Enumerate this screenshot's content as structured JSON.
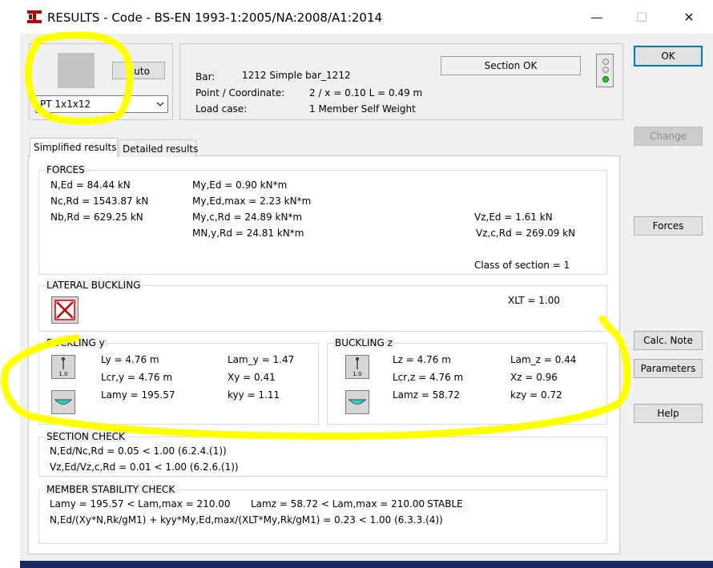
{
  "window": {
    "title": "RESULTS - Code - BS-EN 1993-1:2005/NA:2008/A1:2014",
    "minimize": "—",
    "maximize": "☐",
    "close": "✕"
  },
  "section_picker": {
    "auto_label": "Auto",
    "selected": "PT 1x1x12"
  },
  "info": {
    "bar_label": "Bar:",
    "bar_value": "1212  Simple bar_1212",
    "point_label": "Point / Coordinate:",
    "point_value": "2 / x = 0.10 L = 0.49 m",
    "load_label": "Load case:",
    "load_value": "1 Member Self Weight",
    "status": "Section OK",
    "status_color": "#22cc22"
  },
  "buttons": {
    "ok": "OK",
    "change": "Change",
    "forces": "Forces",
    "calc_note": "Calc. Note",
    "parameters": "Parameters",
    "help": "Help"
  },
  "tabs": [
    "Simplified results",
    "Detailed results"
  ],
  "forces": {
    "title": "FORCES",
    "n_ed": "N,Ed = 84.44 kN",
    "nc_rd": "Nc,Rd = 1543.87 kN",
    "nb_rd": "Nb,Rd = 629.25 kN",
    "my_ed": "My,Ed = 0.90 kN*m",
    "my_ed_max": "My,Ed,max = 2.23 kN*m",
    "my_c_rd": "My,c,Rd = 24.89 kN*m",
    "mn_y_rd": "MN,y,Rd = 24.81 kN*m",
    "vz_ed": "Vz,Ed = 1.61 kN",
    "vz_c_rd": "Vz,c,Rd = 269.09 kN",
    "class": "Class of section = 1"
  },
  "lateral": {
    "title": "LATERAL BUCKLING",
    "xlt": "XLT = 1.00"
  },
  "buckling_y": {
    "title": "BUCKLING y",
    "icon_label": "1.0",
    "ly": "Ly = 4.76 m",
    "lcr": "Lcr,y = 4.76 m",
    "lam": "Lamy = 195.57",
    "lam_rel": "Lam_y = 1.47",
    "x": "Xy = 0.41",
    "k": "kyy = 1.11"
  },
  "buckling_z": {
    "title": "BUCKLING z",
    "icon_label": "1.0",
    "lz": "Lz = 4.76 m",
    "lcr": "Lcr,z = 4.76 m",
    "lam": "Lamz = 58.72",
    "lam_rel": "Lam_z = 0.44",
    "x": "Xz = 0.96",
    "k": "kzy = 0.72"
  },
  "section_check": {
    "title": "SECTION CHECK",
    "line1": "N,Ed/Nc,Rd = 0.05 < 1.00   (6.2.4.(1))",
    "line2": "Vz,Ed/Vz,c,Rd = 0.01 < 1.00   (6.2.6.(1))"
  },
  "stability": {
    "title": "MEMBER STABILITY CHECK",
    "line1a": "Lamy = 195.57 < Lam,max = 210.00",
    "line1b": "Lamz = 58.72 < Lam,max = 210.00",
    "line1c": "STABLE",
    "line2": "N,Ed/(Xy*N,Rk/gM1) + kyy*My,Ed,max/(XLT*My,Rk/gM1) = 0.23 < 1.00   (6.3.3.(4))"
  },
  "highlight_color": "#ffff00"
}
